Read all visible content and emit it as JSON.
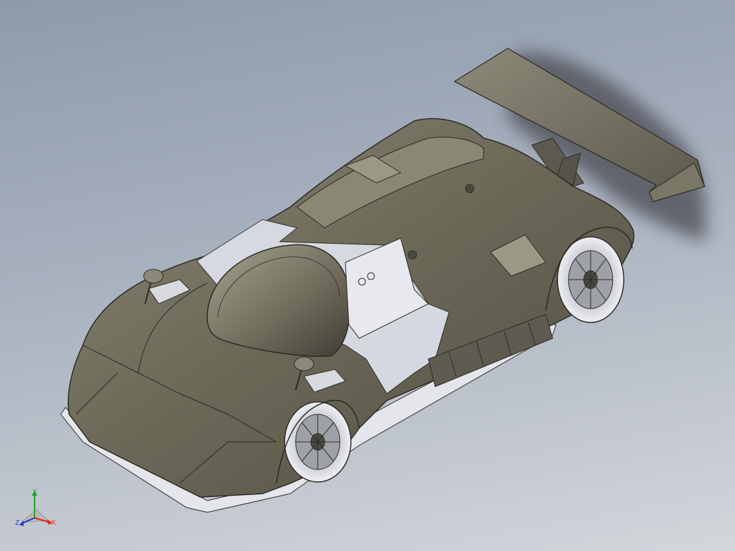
{
  "viewport": {
    "background_top": "#8e9aac",
    "background_bottom": "#d3d6db"
  },
  "model": {
    "name": "race-car-assembly",
    "body_color": "#6e6b5b",
    "edge_color": "#2b2a24",
    "stripe_color": "#dcdfe8",
    "shadow_color": "#5a5a5e"
  },
  "triad": {
    "x_label": "X",
    "y_label": "Y",
    "z_label": "Z",
    "x_color": "#e0241c",
    "y_color": "#1fa52a",
    "z_color": "#2432c8"
  }
}
